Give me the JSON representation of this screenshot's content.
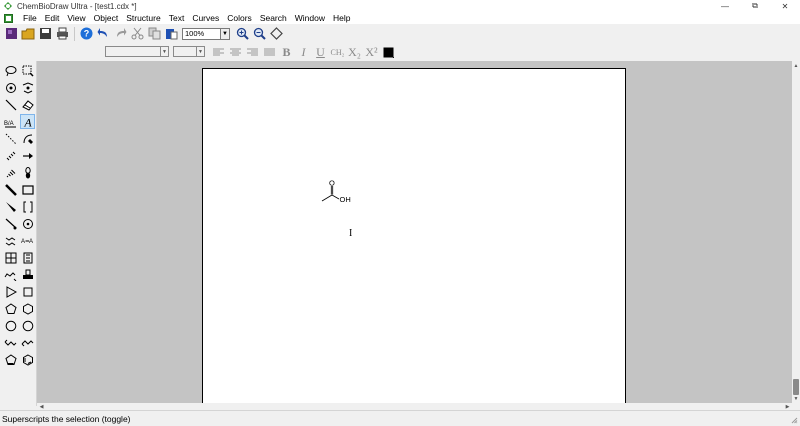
{
  "window": {
    "title": "ChemBioDraw Ultra - [test1.cdx *]",
    "controls": [
      "—",
      "⧉",
      "✕"
    ]
  },
  "menubar": {
    "items": [
      "File",
      "Edit",
      "View",
      "Object",
      "Structure",
      "Text",
      "Curves",
      "Colors",
      "Search",
      "Window",
      "Help"
    ]
  },
  "toolbar": {
    "zoom_value": "100%"
  },
  "format_toolbar": {
    "bold": "B",
    "italic": "I",
    "underline": "U",
    "formula": "CH₂",
    "subscript": "X₂",
    "superscript": "X²",
    "color": "#000000"
  },
  "canvas": {
    "molecule": {
      "atoms": [
        "O",
        "OH"
      ]
    },
    "cursor_icon": "i-beam-cursor"
  },
  "statusbar": {
    "text": "Superscripts the selection (toggle)"
  },
  "colors": {
    "chrome": "#f0f0f0",
    "workspace": "#c4c4c4",
    "page": "#ffffff",
    "accent": "#1e6fd9",
    "logo_green": "#3a9a3a"
  }
}
